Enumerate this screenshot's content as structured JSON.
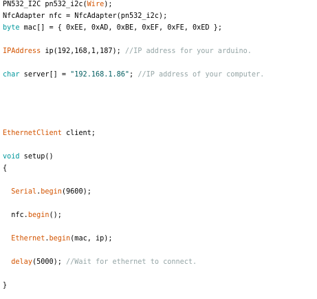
{
  "lines": [
    {
      "segments": [
        {
          "text": "PN532_I2C pn532_i2c(",
          "style": "plain"
        },
        {
          "text": "Wire",
          "style": "kw-orange"
        },
        {
          "text": ");",
          "style": "plain"
        }
      ]
    },
    {
      "segments": [
        {
          "text": "NfcAdapter nfc = NfcAdapter(pn532_i2c);",
          "style": "plain"
        }
      ]
    },
    {
      "segments": [
        {
          "text": "byte",
          "style": "kw-type"
        },
        {
          "text": " mac[] = { 0xEE, 0xAD, 0xBE, 0xEF, 0xFE, 0xED };",
          "style": "plain"
        }
      ]
    },
    {
      "segments": [
        {
          "text": "IPAddress",
          "style": "kw-orange"
        },
        {
          "text": " ip(192,168,1,187); ",
          "style": "plain"
        },
        {
          "text": "//IP address for your arduino.",
          "style": "cmt"
        }
      ]
    },
    {
      "segments": [
        {
          "text": "char",
          "style": "kw-type"
        },
        {
          "text": " server[] = ",
          "style": "plain"
        },
        {
          "text": "\"192.168.1.86\"",
          "style": "str"
        },
        {
          "text": "; ",
          "style": "plain"
        },
        {
          "text": "//IP address of your computer.",
          "style": "cmt"
        }
      ]
    },
    {
      "segments": [
        {
          "text": "EthernetClient",
          "style": "kw-orange"
        },
        {
          "text": " client;",
          "style": "plain"
        }
      ]
    },
    {
      "segments": [
        {
          "text": "void",
          "style": "kw-type"
        },
        {
          "text": " setup()",
          "style": "plain"
        }
      ]
    },
    {
      "segments": [
        {
          "text": "{",
          "style": "plain"
        }
      ]
    },
    {
      "segments": [
        {
          "text": "  ",
          "style": "plain"
        },
        {
          "text": "Serial",
          "style": "kw-orange"
        },
        {
          "text": ".",
          "style": "plain"
        },
        {
          "text": "begin",
          "style": "kw-orange"
        },
        {
          "text": "(9600);",
          "style": "plain"
        }
      ]
    },
    {
      "segments": [
        {
          "text": "  nfc.",
          "style": "plain"
        },
        {
          "text": "begin",
          "style": "kw-orange"
        },
        {
          "text": "();",
          "style": "plain"
        }
      ]
    },
    {
      "segments": [
        {
          "text": "  ",
          "style": "plain"
        },
        {
          "text": "Ethernet",
          "style": "kw-orange"
        },
        {
          "text": ".",
          "style": "plain"
        },
        {
          "text": "begin",
          "style": "kw-orange"
        },
        {
          "text": "(mac, ip);",
          "style": "plain"
        }
      ]
    },
    {
      "segments": [
        {
          "text": "  ",
          "style": "plain"
        },
        {
          "text": "delay",
          "style": "kw-orange"
        },
        {
          "text": "(5000); ",
          "style": "plain"
        },
        {
          "text": "//Wait for ethernet to connect.",
          "style": "cmt"
        }
      ]
    },
    {
      "segments": [
        {
          "text": "}",
          "style": "plain"
        }
      ]
    }
  ],
  "colors": {
    "background": "#ffffff",
    "keyword_teal": "#00979c",
    "keyword_orange": "#d35400",
    "string": "#005c5f",
    "comment": "#95a5a6"
  }
}
